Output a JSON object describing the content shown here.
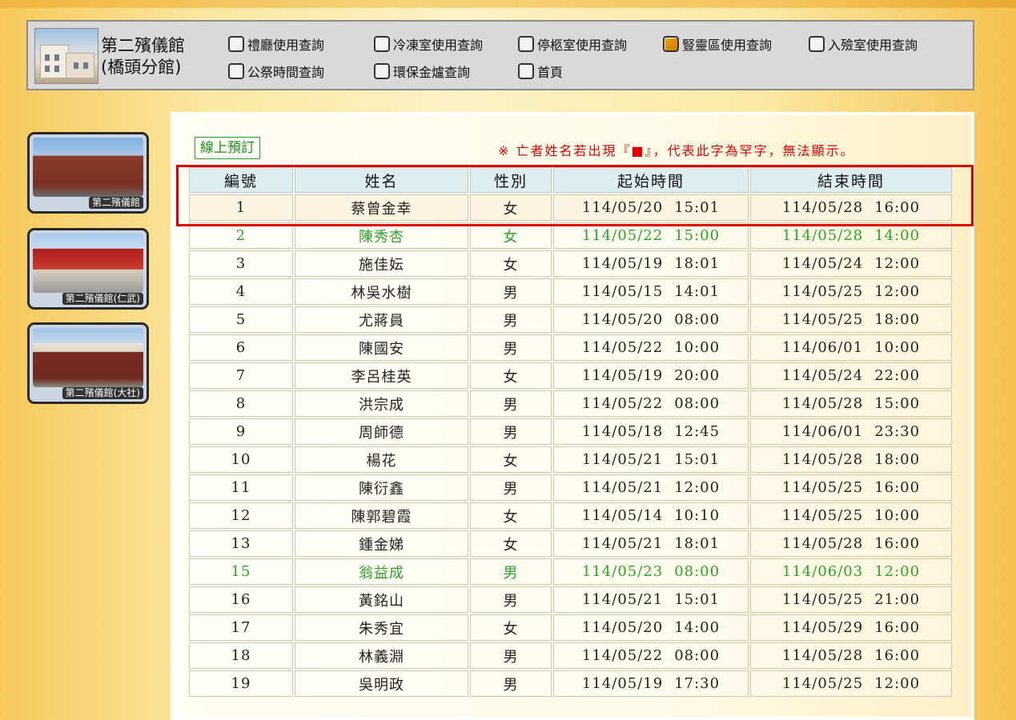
{
  "header": {
    "logo_line1": "第二殯儀館",
    "logo_line2": "(橋頭分館)",
    "nav": [
      {
        "label": "禮廳使用查詢",
        "active": false
      },
      {
        "label": "冷凍室使用查詢",
        "active": false
      },
      {
        "label": "停柩室使用查詢",
        "active": false
      },
      {
        "label": "豎靈區使用查詢",
        "active": true
      },
      {
        "label": "入殮室使用查詢",
        "active": false
      },
      {
        "label": "公祭時間查詢",
        "active": false
      },
      {
        "label": "環保金爐查詢",
        "active": false
      },
      {
        "label": "首頁",
        "active": false
      }
    ]
  },
  "sidebar": {
    "items": [
      {
        "caption": "第二殯儀館"
      },
      {
        "caption": "第二殯儀館(仁武)"
      },
      {
        "caption": "第二殯儀館(大社)"
      }
    ]
  },
  "main": {
    "online_button": "線上預訂",
    "notice": "※ 亡者姓名若出現『■』，代表此字為罕字，無法顯示。",
    "columns": [
      "編號",
      "姓名",
      "性別",
      "起始時間",
      "結束時間"
    ],
    "rows": [
      {
        "no": "1",
        "name": "蔡曾金幸",
        "sex": "女",
        "start_date": "114/05/20",
        "start_time": "15:01",
        "end_date": "114/05/28",
        "end_time": "16:00",
        "green": false
      },
      {
        "no": "2",
        "name": "陳秀杏",
        "sex": "女",
        "start_date": "114/05/22",
        "start_time": "15:00",
        "end_date": "114/05/28",
        "end_time": "14:00",
        "green": true
      },
      {
        "no": "3",
        "name": "施佳妘",
        "sex": "女",
        "start_date": "114/05/19",
        "start_time": "18:01",
        "end_date": "114/05/24",
        "end_time": "12:00",
        "green": false
      },
      {
        "no": "4",
        "name": "林吳水樹",
        "sex": "男",
        "start_date": "114/05/15",
        "start_time": "14:01",
        "end_date": "114/05/25",
        "end_time": "12:00",
        "green": false
      },
      {
        "no": "5",
        "name": "尤蔣員",
        "sex": "男",
        "start_date": "114/05/20",
        "start_time": "08:00",
        "end_date": "114/05/25",
        "end_time": "18:00",
        "green": false
      },
      {
        "no": "6",
        "name": "陳國安",
        "sex": "男",
        "start_date": "114/05/22",
        "start_time": "10:00",
        "end_date": "114/06/01",
        "end_time": "10:00",
        "green": false
      },
      {
        "no": "7",
        "name": "李呂桂英",
        "sex": "女",
        "start_date": "114/05/19",
        "start_time": "20:00",
        "end_date": "114/05/24",
        "end_time": "22:00",
        "green": false
      },
      {
        "no": "8",
        "name": "洪宗成",
        "sex": "男",
        "start_date": "114/05/22",
        "start_time": "08:00",
        "end_date": "114/05/28",
        "end_time": "15:00",
        "green": false
      },
      {
        "no": "9",
        "name": "周師德",
        "sex": "男",
        "start_date": "114/05/18",
        "start_time": "12:45",
        "end_date": "114/06/01",
        "end_time": "23:30",
        "green": false
      },
      {
        "no": "10",
        "name": "楊花",
        "sex": "女",
        "start_date": "114/05/21",
        "start_time": "15:01",
        "end_date": "114/05/28",
        "end_time": "18:00",
        "green": false
      },
      {
        "no": "11",
        "name": "陳衍鑫",
        "sex": "男",
        "start_date": "114/05/21",
        "start_time": "12:00",
        "end_date": "114/05/25",
        "end_time": "16:00",
        "green": false
      },
      {
        "no": "12",
        "name": "陳郭碧霞",
        "sex": "女",
        "start_date": "114/05/14",
        "start_time": "10:10",
        "end_date": "114/05/25",
        "end_time": "10:00",
        "green": false
      },
      {
        "no": "13",
        "name": "鍾金娣",
        "sex": "女",
        "start_date": "114/05/21",
        "start_time": "18:01",
        "end_date": "114/05/28",
        "end_time": "16:00",
        "green": false
      },
      {
        "no": "15",
        "name": "翁益成",
        "sex": "男",
        "start_date": "114/05/23",
        "start_time": "08:00",
        "end_date": "114/06/03",
        "end_time": "12:00",
        "green": true
      },
      {
        "no": "16",
        "name": "黃銘山",
        "sex": "男",
        "start_date": "114/05/21",
        "start_time": "15:01",
        "end_date": "114/05/25",
        "end_time": "21:00",
        "green": false
      },
      {
        "no": "17",
        "name": "朱秀宜",
        "sex": "女",
        "start_date": "114/05/20",
        "start_time": "14:00",
        "end_date": "114/05/29",
        "end_time": "16:00",
        "green": false
      },
      {
        "no": "18",
        "name": "林義淵",
        "sex": "男",
        "start_date": "114/05/22",
        "start_time": "08:00",
        "end_date": "114/05/28",
        "end_time": "16:00",
        "green": false
      },
      {
        "no": "19",
        "name": "吳明政",
        "sex": "男",
        "start_date": "114/05/19",
        "start_time": "17:30",
        "end_date": "114/05/25",
        "end_time": "12:00",
        "green": false
      }
    ]
  },
  "colors": {
    "highlight": "#e00000",
    "green_text": "#2aa52a",
    "header_cell": "#ddeef0"
  }
}
